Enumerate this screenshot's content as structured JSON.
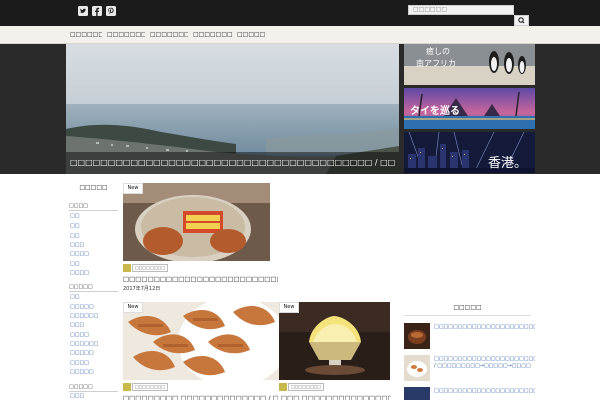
{
  "header": {
    "social_icons": [
      "twitter-icon",
      "facebook-icon",
      "pinterest-icon"
    ],
    "search": {
      "placeholder": "□□□□□□",
      "button_icon": "search-icon"
    }
  },
  "nav": {
    "items": [
      {
        "label": "□□□□□□□□□"
      },
      {
        "label": "□□□□□□□□□□"
      },
      {
        "label": "□□□□□□□□□"
      },
      {
        "label": "□□□□□□□□□□"
      },
      {
        "label": "□□□□□□□"
      }
    ]
  },
  "hero": {
    "caption": "□□□□□□□□□□□□□□□□□□□□□□□□□□□□□□□□□□□□□□□□ / □□□□□□"
  },
  "banners": [
    {
      "label_top": "癒しの",
      "label_bottom": "南アフリカ"
    },
    {
      "label": "タイを巡る"
    },
    {
      "label": "香港。"
    }
  ],
  "left_sidebar": {
    "title": "□□□□□",
    "sections": [
      {
        "heading": "□□□□",
        "links": [
          "□□",
          "□□",
          "□□",
          "□□□",
          "□□□□",
          "□□",
          "□□□□"
        ]
      },
      {
        "heading": "□□□□□",
        "links": [
          "□□",
          "□□□□□",
          "□□□□□□",
          "□□□",
          "□□□□",
          "□□□□□□",
          "□□□□□",
          "□□□□",
          "□□□□□"
        ]
      },
      {
        "heading": "□□□□□",
        "links": [
          "□□□"
        ]
      }
    ]
  },
  "main": {
    "posts": [
      {
        "badge": "New",
        "category": "□□□□□□□□",
        "title": "□□□□□□□□□□□□□□□□□□□□□□□□□□□□□□□□□□□□□□",
        "date": "2017年7月12日"
      },
      {
        "badge": "New",
        "category": "□□□□□□□□",
        "title": "□□□□□□□□□ □□□□□□□□□□□□□□ / □□□"
      },
      {
        "badge": "New",
        "category": "□□□□□□□□",
        "title": "□□□ □□□□□□□□□□□□□□□□□□□ / □□□"
      }
    ]
  },
  "right_sidebar": {
    "title": "□□□□□",
    "items": [
      {
        "text": "□□□□□□□□□□□□□□□□□□□□□□□□□□□□□□□□"
      },
      {
        "text": "□□□□□□□□□□□□□□□□□□□□□□□□□□□□□□ / □□□□□□□□□→□□□□□→□□□□"
      },
      {
        "text": "□□□□□□□□□□□□□□□□□□□□□□□□□□□□□□○□□□"
      }
    ]
  }
}
